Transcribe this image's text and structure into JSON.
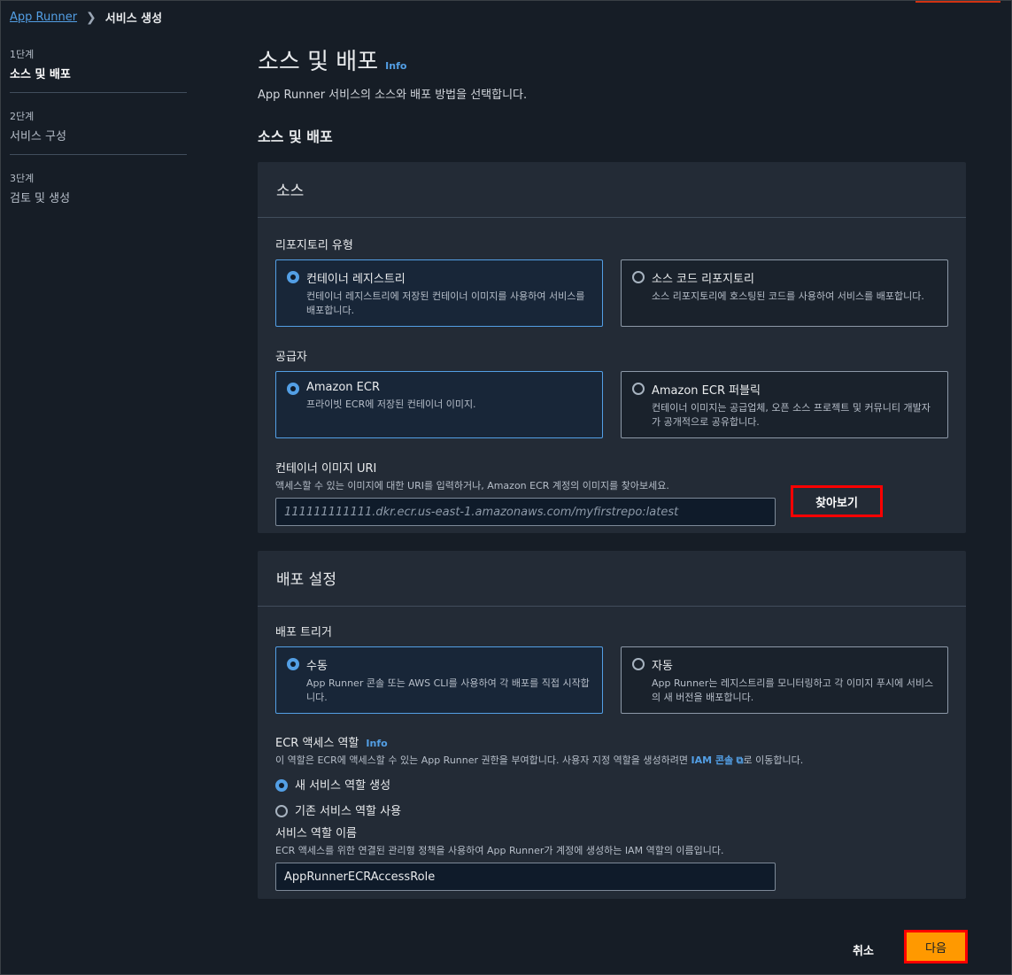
{
  "breadcrumb": {
    "service": "App Runner",
    "current": "서비스 생성"
  },
  "steps": [
    {
      "num": "1단계",
      "label": "소스 및 배포"
    },
    {
      "num": "2단계",
      "label": "서비스 구성"
    },
    {
      "num": "3단계",
      "label": "검토 및 생성"
    }
  ],
  "page": {
    "title": "소스 및 배포",
    "info": "Info",
    "description": "App Runner 서비스의 소스와 배포 방법을 선택합니다.",
    "section_heading": "소스 및 배포"
  },
  "source_panel": {
    "title": "소스",
    "repo_type_label": "리포지토리 유형",
    "repo_options": [
      {
        "title": "컨테이너 레지스트리",
        "desc": "컨테이너 레지스트리에 저장된 컨테이너 이미지를 사용하여 서비스를 배포합니다."
      },
      {
        "title": "소스 코드 리포지토리",
        "desc": "소스 리포지토리에 호스팅된 코드를 사용하여 서비스를 배포합니다."
      }
    ],
    "provider_label": "공급자",
    "provider_options": [
      {
        "title": "Amazon ECR",
        "desc": "프라이빗 ECR에 저장된 컨테이너 이미지."
      },
      {
        "title": "Amazon ECR 퍼블릭",
        "desc": "컨테이너 이미지는 공급업체, 오픈 소스 프로젝트 및 커뮤니티 개발자가 공개적으로 공유합니다."
      }
    ],
    "image_uri_label": "컨테이너 이미지 URI",
    "image_uri_desc": "액세스할 수 있는 이미지에 대한 URI를 입력하거나, Amazon ECR 계정의 이미지를 찾아보세요.",
    "image_uri_placeholder": "111111111111.dkr.ecr.us-east-1.amazonaws.com/myfirstrepo:latest",
    "browse_button": "찾아보기"
  },
  "deploy_panel": {
    "title": "배포 설정",
    "trigger_label": "배포 트리거",
    "trigger_options": [
      {
        "title": "수동",
        "desc": "App Runner 콘솔 또는 AWS CLI를 사용하여 각 배포를 직접 시작합니다."
      },
      {
        "title": "자동",
        "desc": "App Runner는 레지스트리를 모니터링하고 각 이미지 푸시에 서비스의 새 버전을 배포합니다."
      }
    ],
    "ecr_role_label": "ECR 액세스 역할",
    "ecr_role_info": "Info",
    "ecr_role_desc_prefix": "이 역할은 ECR에 액세스할 수 있는 App Runner 권한을 부여합니다. 사용자 지정 역할을 생성하려면",
    "iam_console_link": "IAM 콘솔",
    "ecr_role_desc_suffix": "로 이동합니다.",
    "role_options": [
      "새 서비스 역할 생성",
      "기존 서비스 역할 사용"
    ],
    "role_name_label": "서비스 역할 이름",
    "role_name_desc": "ECR 액세스를 위한 연결된 관리형 정책을 사용하여 App Runner가 계정에 생성하는 IAM 역할의 이름입니다.",
    "role_name_value": "AppRunnerECRAccessRole"
  },
  "footer": {
    "cancel": "취소",
    "next": "다음"
  },
  "colors": {
    "accent": "#539fe5",
    "primary_button": "#ff9900",
    "highlight_box": "#ff0000"
  }
}
